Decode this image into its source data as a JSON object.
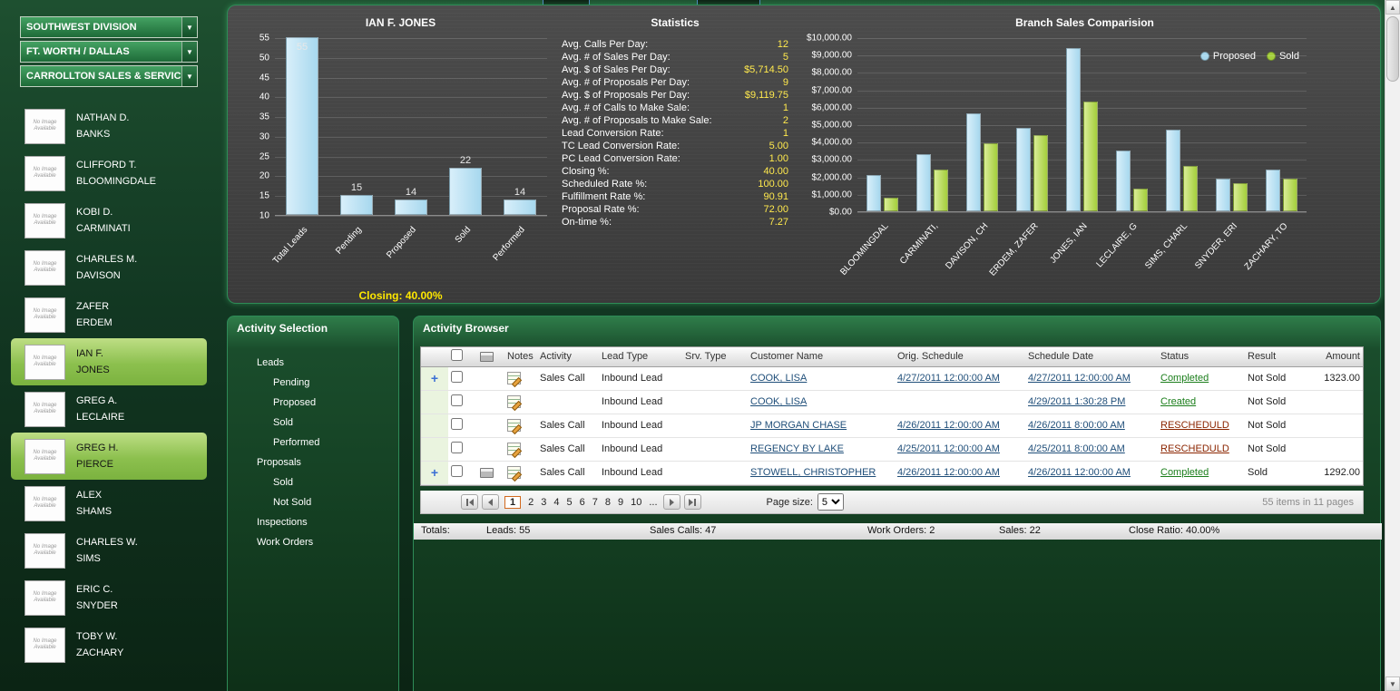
{
  "icons": {
    "dropdown_arrow": "▼",
    "scroll_up_arrow": "▲",
    "scroll_down_arrow": "▼",
    "expand_plus": "+"
  },
  "filters": {
    "division": "SOUTHWEST DIVISION",
    "region": "FT. WORTH / DALLAS",
    "branch": "CARROLLTON SALES & SERVICE T"
  },
  "salespeople": {
    "placeholder_text": "No Image Available",
    "items": [
      {
        "first": "NATHAN D.",
        "last": "BANKS",
        "selected": false
      },
      {
        "first": "CLIFFORD T.",
        "last": "BLOOMINGDALE",
        "selected": false
      },
      {
        "first": "KOBI D.",
        "last": "CARMINATI",
        "selected": false
      },
      {
        "first": "CHARLES M.",
        "last": "DAVISON",
        "selected": false
      },
      {
        "first": "ZAFER",
        "last": "ERDEM",
        "selected": false
      },
      {
        "first": "IAN F.",
        "last": "JONES",
        "selected": true
      },
      {
        "first": "GREG A.",
        "last": "LECLAIRE",
        "selected": false
      },
      {
        "first": "GREG H.",
        "last": "PIERCE",
        "selected": true
      },
      {
        "first": "ALEX",
        "last": "SHAMS",
        "selected": false
      },
      {
        "first": "CHARLES W.",
        "last": "SIMS",
        "selected": false
      },
      {
        "first": "ERIC C.",
        "last": "SNYDER",
        "selected": false
      },
      {
        "first": "TOBY W.",
        "last": "ZACHARY",
        "selected": false
      }
    ]
  },
  "dashboard": {
    "closing_label": "Closing: 40.00%",
    "statistics": {
      "title": "Statistics",
      "rows": [
        {
          "label": "Avg. Calls Per Day:",
          "value": "12"
        },
        {
          "label": "Avg. # of Sales Per Day:",
          "value": "5"
        },
        {
          "label": "Avg. $ of Sales Per Day:",
          "value": "$5,714.50"
        },
        {
          "label": "Avg. # of Proposals Per Day:",
          "value": "9"
        },
        {
          "label": "Avg. $ of Proposals Per Day:",
          "value": "$9,119.75"
        },
        {
          "label": "Avg. # of Calls to Make Sale:",
          "value": "1"
        },
        {
          "label": "Avg. # of Proposals to Make Sale:",
          "value": "2"
        },
        {
          "label": "Lead Conversion Rate:",
          "value": "1"
        },
        {
          "label": "TC Lead Conversion Rate:",
          "value": "5.00"
        },
        {
          "label": "PC Lead Conversion Rate:",
          "value": "1.00"
        },
        {
          "label": "Closing %:",
          "value": "40.00"
        },
        {
          "label": "Scheduled Rate %:",
          "value": "100.00"
        },
        {
          "label": "Fulfillment Rate %:",
          "value": "90.91"
        },
        {
          "label": "Proposal Rate %:",
          "value": "72.00"
        },
        {
          "label": "On-time %:",
          "value": "7.27"
        }
      ]
    }
  },
  "chart_data": [
    {
      "type": "bar",
      "title": "IAN F. JONES",
      "categories": [
        "Total Leads",
        "Pending",
        "Proposed",
        "Sold",
        "Performed"
      ],
      "values": [
        55,
        15,
        14,
        22,
        14
      ],
      "ylim": [
        10,
        55
      ],
      "yticks": [
        55,
        50,
        45,
        40,
        35,
        30,
        25,
        20,
        15,
        10
      ],
      "color": "#a7d8ee",
      "color_light": "#d8effa",
      "grid": true,
      "footer": "Closing: 40.00%"
    },
    {
      "type": "bar",
      "title": "Branch Sales Comparision",
      "categories": [
        "BLOOMINGDAL",
        "CARMINATI,",
        "DAVISON, CH",
        "ERDEM, ZAFER",
        "JONES, IAN",
        "LECLAIRE, G",
        "SIMS, CHARL",
        "SNYDER, ERI",
        "ZACHARY, TO"
      ],
      "series": [
        {
          "name": "Proposed",
          "color": "#a7d8ee",
          "color_light": "#d8effa",
          "values": [
            2100,
            3300,
            5600,
            4800,
            9400,
            3500,
            4700,
            1900,
            2400
          ]
        },
        {
          "name": "Sold",
          "color": "#a4cf3c",
          "color_light": "#d9ec96",
          "values": [
            800,
            2400,
            3900,
            4400,
            6300,
            1300,
            2600,
            1600,
            1900
          ]
        }
      ],
      "ylim": [
        0,
        10000
      ],
      "ytick_step": 1000,
      "legend_position": "top-right",
      "grid": true
    }
  ],
  "activity_selection": {
    "title": "Activity Selection",
    "tree": [
      {
        "label": "Leads",
        "level": 0
      },
      {
        "label": "Pending",
        "level": 1
      },
      {
        "label": "Proposed",
        "level": 1
      },
      {
        "label": "Sold",
        "level": 1
      },
      {
        "label": "Performed",
        "level": 1
      },
      {
        "label": "Proposals",
        "level": 0
      },
      {
        "label": "Sold",
        "level": 1
      },
      {
        "label": "Not Sold",
        "level": 1
      },
      {
        "label": "Inspections",
        "level": 0
      },
      {
        "label": "Work Orders",
        "level": 0
      }
    ]
  },
  "activity_browser": {
    "title": "Activity Browser",
    "columns": [
      "Notes",
      "Activity",
      "Lead Type",
      "Srv. Type",
      "Customer Name",
      "Orig. Schedule",
      "Schedule Date",
      "Status",
      "Result",
      "Amount"
    ],
    "status_colors": {
      "Completed": "#1b7e1b",
      "Created": "#1b7e1b",
      "RESCHEDULD": "#8b2500"
    },
    "rows": [
      {
        "expand": true,
        "print": false,
        "notes": true,
        "activity": "Sales Call",
        "lead_type": "Inbound Lead",
        "srv_type": "",
        "customer": "COOK, LISA",
        "orig_schedule": "4/27/2011 12:00:00 AM",
        "schedule_date": "4/27/2011 12:00:00 AM",
        "status": "Completed",
        "result": "Not Sold",
        "amount": "1323.00"
      },
      {
        "expand": false,
        "print": false,
        "notes": true,
        "activity": "",
        "lead_type": "Inbound Lead",
        "srv_type": "",
        "customer": "COOK, LISA",
        "orig_schedule": "",
        "schedule_date": "4/29/2011 1:30:28 PM",
        "status": "Created",
        "result": "Not Sold",
        "amount": ""
      },
      {
        "expand": false,
        "print": false,
        "notes": true,
        "activity": "Sales Call",
        "lead_type": "Inbound Lead",
        "srv_type": "",
        "customer": "JP MORGAN CHASE",
        "orig_schedule": "4/26/2011 12:00:00 AM",
        "schedule_date": "4/26/2011 8:00:00 AM",
        "status": "RESCHEDULD",
        "result": "Not Sold",
        "amount": ""
      },
      {
        "expand": false,
        "print": false,
        "notes": true,
        "activity": "Sales Call",
        "lead_type": "Inbound Lead",
        "srv_type": "",
        "customer": "REGENCY BY LAKE",
        "orig_schedule": "4/25/2011 12:00:00 AM",
        "schedule_date": "4/25/2011 8:00:00 AM",
        "status": "RESCHEDULD",
        "result": "Not Sold",
        "amount": ""
      },
      {
        "expand": true,
        "print": true,
        "notes": true,
        "activity": "Sales Call",
        "lead_type": "Inbound Lead",
        "srv_type": "",
        "customer": "STOWELL, CHRISTOPHER",
        "orig_schedule": "4/26/2011 12:00:00 AM",
        "schedule_date": "4/26/2011 12:00:00 AM",
        "status": "Completed",
        "result": "Sold",
        "amount": "1292.00"
      }
    ],
    "pager": {
      "pages": [
        "1",
        "2",
        "3",
        "4",
        "5",
        "6",
        "7",
        "8",
        "9",
        "10",
        "..."
      ],
      "current": "1",
      "page_size_label": "Page size:",
      "page_size": "5",
      "summary": "55 items in 11 pages"
    }
  },
  "totals": {
    "label": "Totals:",
    "items": [
      {
        "label": "Leads:",
        "value": "55"
      },
      {
        "label": "Sales Calls:",
        "value": "47"
      },
      {
        "label": "Work Orders:",
        "value": "2"
      },
      {
        "label": "Sales:",
        "value": "22"
      },
      {
        "label": "Close Ratio:",
        "value": "40.00%"
      }
    ]
  }
}
